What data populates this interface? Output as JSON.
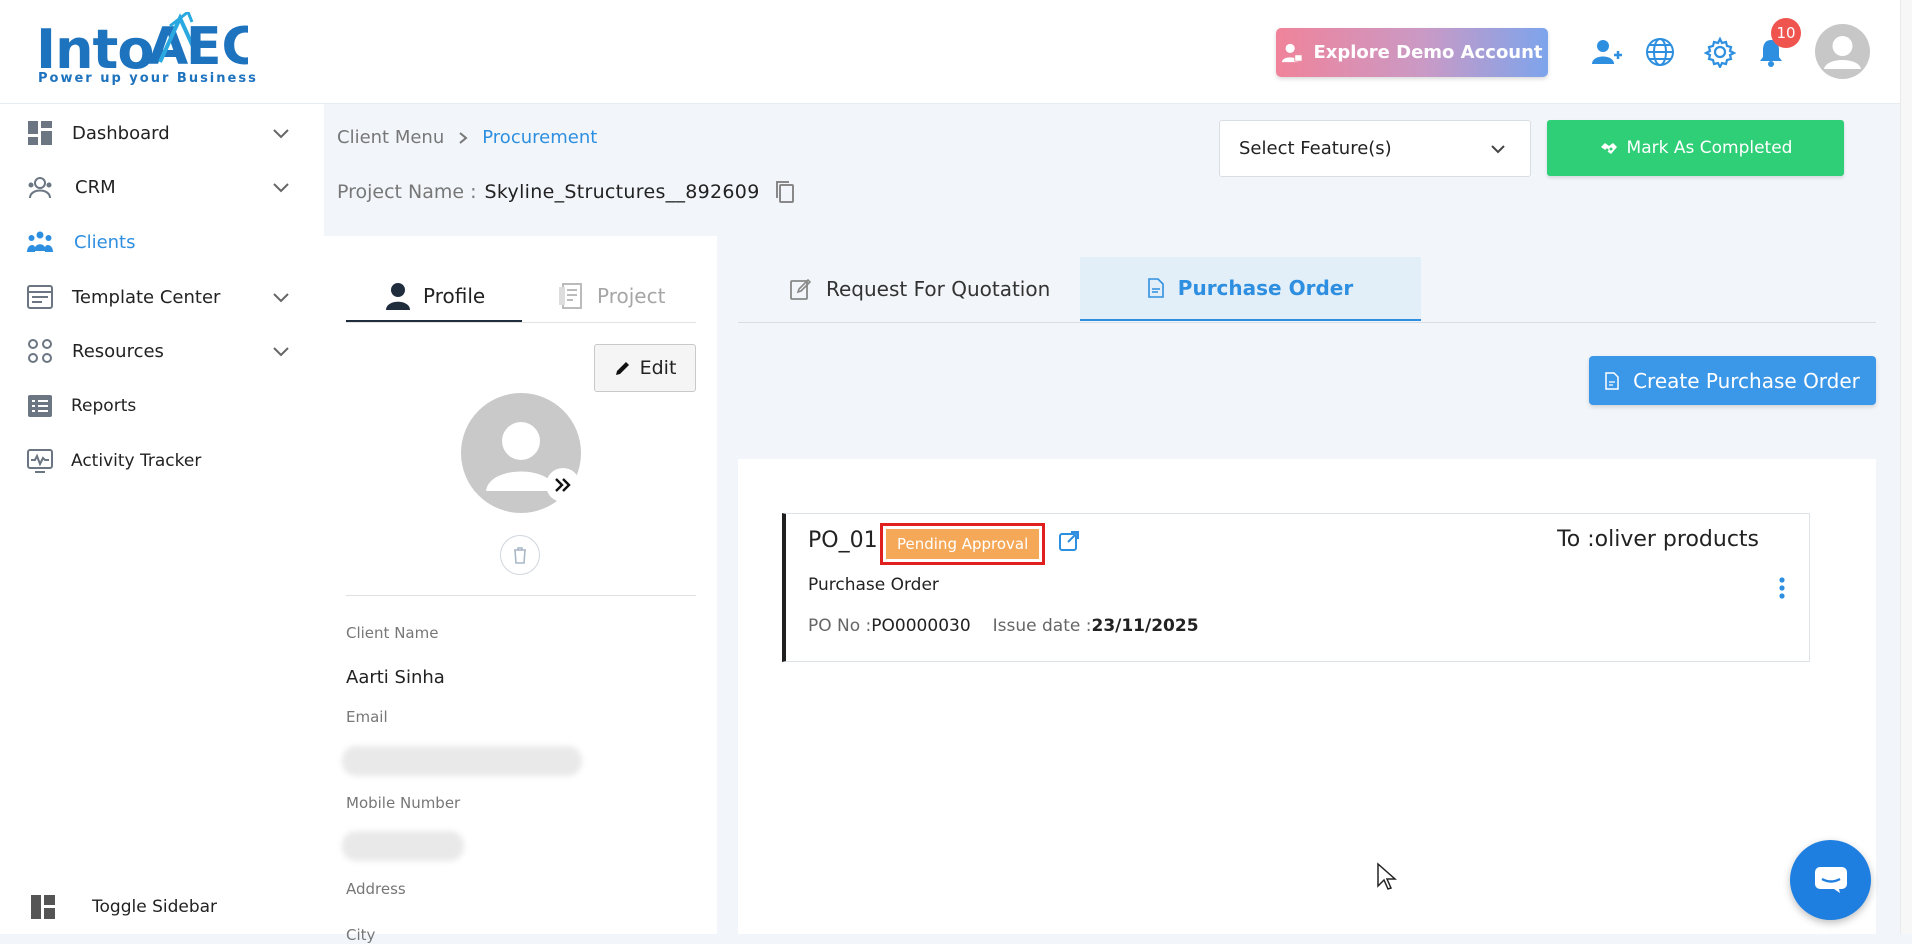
{
  "app": {
    "logo_text": "IntoAEC",
    "logo_tagline": "Power up your Business",
    "demo_button": "Explore Demo Account",
    "notification_count": "10"
  },
  "sidebar": {
    "items": [
      {
        "label": "Dashboard",
        "icon": "dashboard-icon",
        "expandable": true
      },
      {
        "label": "CRM",
        "icon": "crm-icon",
        "expandable": true
      },
      {
        "label": "Clients",
        "icon": "clients-icon",
        "active": true
      },
      {
        "label": "Template Center",
        "icon": "template-icon",
        "expandable": true
      },
      {
        "label": "Resources",
        "icon": "resources-icon",
        "expandable": true
      },
      {
        "label": "Reports",
        "icon": "reports-icon"
      },
      {
        "label": "Activity Tracker",
        "icon": "activity-icon"
      }
    ],
    "toggle_label": "Toggle Sidebar"
  },
  "header": {
    "breadcrumb": [
      "Client Menu",
      "Procurement"
    ],
    "project_label": "Project Name :",
    "project_name": "Skyline_Structures__892609",
    "feature_select": "Select Feature(s)",
    "mark_completed": "Mark As Completed"
  },
  "profile": {
    "tabs": [
      "Profile",
      "Project"
    ],
    "edit_label": "Edit",
    "fields": {
      "client_name_label": "Client Name",
      "client_name": "Aarti Sinha",
      "email_label": "Email",
      "mobile_label": "Mobile Number",
      "address_label": "Address",
      "city_label": "City"
    }
  },
  "main": {
    "tabs": [
      "Request For Quotation",
      "Purchase Order"
    ],
    "active_tab": "Purchase Order",
    "create_button": "Create Purchase Order",
    "po": {
      "id": "PO_01",
      "status": "Pending Approval",
      "to": "To :oliver products",
      "type": "Purchase Order",
      "po_no_label": "PO No :",
      "po_no": "PO0000030",
      "issue_label": "Issue date :",
      "issue_date": "23/11/2025"
    }
  },
  "colors": {
    "accent": "#2e8fe0",
    "success": "#2fcf77",
    "pending": "#f5a958",
    "highlight": "#e01f1f"
  }
}
